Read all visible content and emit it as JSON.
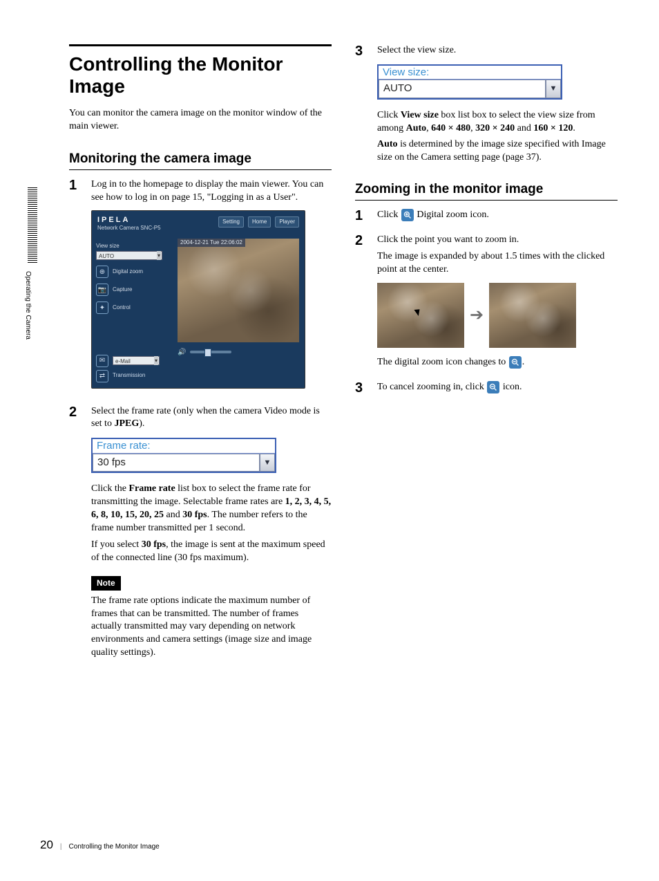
{
  "side_tab": "Operating the Camera",
  "title": "Controlling the Monitor Image",
  "intro": "You can monitor the camera image on the monitor window of the main viewer.",
  "h2a": "Monitoring the camera image",
  "s1a": "Log in to the homepage to display the main viewer. You can see how to log in on page 15, \"Logging in as a User\".",
  "viewer": {
    "brand": "IPELA",
    "brand_sub": "Network Camera SNC-P5",
    "btn_setting": "Setting",
    "btn_home": "Home",
    "btn_player": "Player",
    "viewsize_label": "View size",
    "viewsize_value": "AUTO",
    "m_zoom": "Digital zoom",
    "m_capture": "Capture",
    "m_control": "Control",
    "m_email": "e-Mail",
    "m_trans": "Transmission",
    "timestamp": "2004-12-21 Tue 22:06:02"
  },
  "s2a_1": "Select the frame rate (only when the camera Video mode is set to ",
  "s2a_2_bold": "JPEG",
  "s2a_3": ").",
  "frame_rate_ui": {
    "label": "Frame rate:",
    "value": "30 fps"
  },
  "s2b_1": "Click the ",
  "s2b_2_bold": "Frame rate",
  "s2b_3": " list box to select the frame rate for transmitting the image. Selectable frame rates are ",
  "s2b_rates": "1, 2, 3, 4, 5, 6, 8, 10, 15, 20, 25",
  "s2b_and": " and ",
  "s2b_last": "30 fps",
  "s2b_5": ". The number refers to the frame number transmitted per 1 second.",
  "s2c_1": "If you select ",
  "s2c_2_bold": "30 fps",
  "s2c_3": ", the image is sent at the maximum speed of the connected line (30 fps maximum).",
  "note_label": "Note",
  "note_text": "The frame rate options indicate the maximum number of frames that can be transmitted. The number of frames actually transmitted may vary depending on network environments and camera settings (image size and image quality settings).",
  "s3a": "Select the view size.",
  "viewsize_ui": {
    "label": "View size:",
    "value": "AUTO"
  },
  "s3b_1": "Click ",
  "s3b_2_bold": "View size",
  "s3b_3": " box list box to select the view size from among ",
  "s3b_opts": {
    "a": "Auto",
    "b": "640 × 480",
    "c": "320 × 240",
    "d": "160 × 120"
  },
  "s3b_dot": ".",
  "s3c_1_bold": "Auto",
  "s3c_2": " is determined by the image size specified with Image size on the Camera setting page (page 37).",
  "h2b": "Zooming in the monitor image",
  "zs1_1": "Click ",
  "zs1_2": " Digital zoom icon.",
  "zs2_1": "Click the point you want to zoom in.",
  "zs2_2": "The image is expanded by about 1.5 times with the clicked point at the center.",
  "zs2_3": "The digital zoom icon changes to ",
  "zs3_1": "To cancel zooming in, click ",
  "zs3_2": " icon.",
  "footer": {
    "page": "20",
    "section": "Controlling the Monitor Image"
  }
}
